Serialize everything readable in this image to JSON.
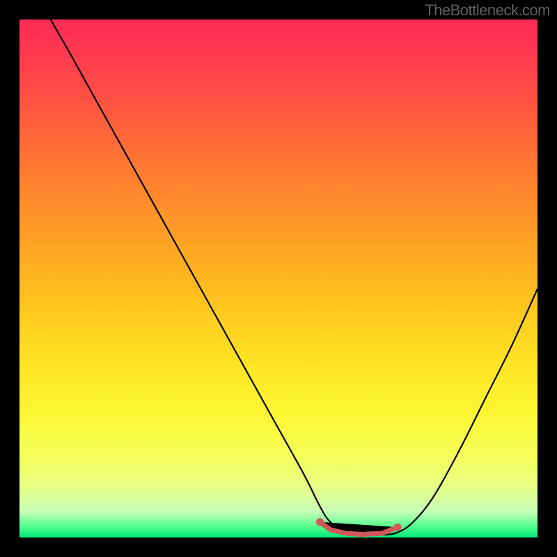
{
  "watermark": "TheBottleneck.com",
  "chart_data": {
    "type": "line",
    "title": "",
    "xlabel": "",
    "ylabel": "",
    "xlim": [
      0,
      100
    ],
    "ylim": [
      0,
      100
    ],
    "grid": false,
    "series": [
      {
        "name": "curve",
        "x": [
          6,
          10,
          15,
          20,
          25,
          30,
          35,
          40,
          45,
          50,
          55,
          58,
          60,
          63,
          66,
          70,
          73,
          76,
          80,
          85,
          90,
          95,
          100
        ],
        "y": [
          100,
          93,
          84,
          75,
          66,
          57,
          48,
          39,
          30,
          21,
          12,
          6,
          3,
          1,
          0.5,
          0.5,
          1,
          3,
          8,
          17,
          27,
          37,
          48
        ]
      }
    ],
    "markers": {
      "name": "highlight",
      "x": [
        58,
        60,
        63,
        66,
        70,
        73
      ],
      "y": [
        3,
        1.5,
        0.8,
        0.6,
        0.8,
        2
      ]
    }
  }
}
